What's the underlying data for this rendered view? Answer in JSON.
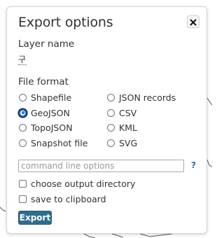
{
  "dialog": {
    "title": "Export options",
    "close_label": "✕"
  },
  "layer": {
    "label": "Layer name",
    "value": "구"
  },
  "format": {
    "label": "File format",
    "selected": "GeoJSON",
    "options": [
      "Shapefile",
      "JSON records",
      "GeoJSON",
      "CSV",
      "TopoJSON",
      "KML",
      "Snapshot file",
      "SVG"
    ]
  },
  "command": {
    "placeholder": "command line options",
    "value": "",
    "help": "?"
  },
  "options": {
    "choose_dir": "choose output directory",
    "clipboard": "save to clipboard"
  },
  "export": {
    "label": "Export"
  },
  "colors": {
    "accent": "#1a73e8",
    "button": "#2e6e8e",
    "help_link": "#2a6fb5"
  }
}
